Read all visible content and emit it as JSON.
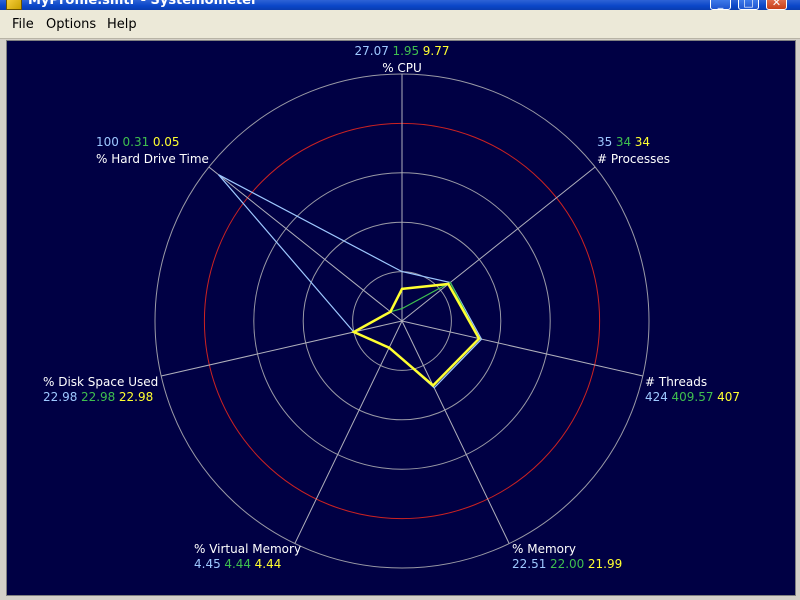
{
  "window": {
    "title": "MyProfile.smtr - Systemometer",
    "min_glyph": "_",
    "max_glyph": "□",
    "close_glyph": "✕"
  },
  "menu": {
    "file": "File",
    "options": "Options",
    "help": "Help"
  },
  "colors": {
    "background": "#000044",
    "ring": "#9a9aa6",
    "red_ring": "#cc2222",
    "axis": "#b0b0bc",
    "value_blue": "#9ec8ff",
    "value_green": "#3fbf4f",
    "value_yellow": "#ffff30",
    "label_white": "#ffffff"
  },
  "chart_data": {
    "type": "radar",
    "axes": [
      {
        "label": "% CPU",
        "values": [
          "27.07",
          "1.95",
          "9.77"
        ]
      },
      {
        "label": "# Processes",
        "values": [
          "35",
          "34",
          "34"
        ]
      },
      {
        "label": "# Threads",
        "values": [
          "424",
          "409.57",
          "407"
        ]
      },
      {
        "label": "% Memory",
        "values": [
          "22.51",
          "22.00",
          "21.99"
        ]
      },
      {
        "label": "% Virtual Memory",
        "values": [
          "4.45",
          "4.44",
          "4.44"
        ]
      },
      {
        "label": "% Disk Space Used",
        "values": [
          "22.98",
          "22.98",
          "22.98"
        ]
      },
      {
        "label": "% Hard Drive Time",
        "values": [
          "100",
          "0.31",
          "0.05"
        ]
      }
    ],
    "series": [
      {
        "color": "#9ec8ff",
        "fraction": [
          0.2,
          0.25,
          0.33,
          0.3,
          0.12,
          0.2,
          0.95
        ]
      },
      {
        "color": "#3fbf4f",
        "fraction": [
          0.05,
          0.25,
          0.32,
          0.29,
          0.12,
          0.2,
          0.06
        ]
      },
      {
        "color": "#ffff30",
        "fraction": [
          0.13,
          0.24,
          0.32,
          0.29,
          0.12,
          0.2,
          0.06
        ]
      }
    ],
    "rings": 5,
    "red_ring_index": 4
  }
}
